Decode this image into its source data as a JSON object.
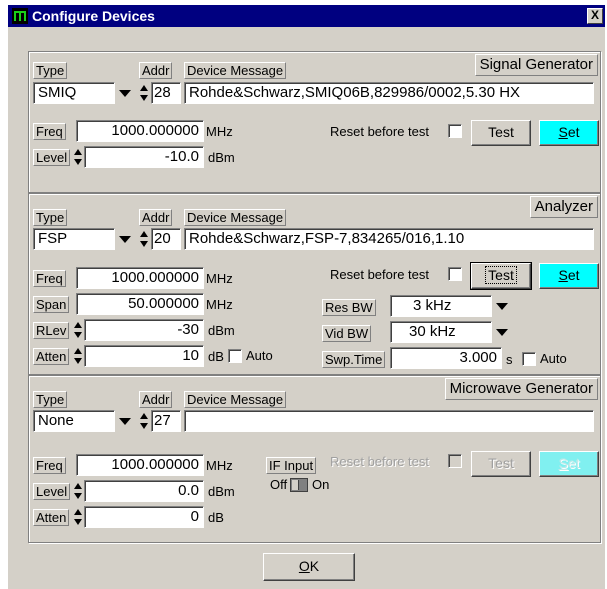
{
  "window": {
    "title": "Configure Devices",
    "close_label": "X"
  },
  "common": {
    "type_label": "Type",
    "addr_label": "Addr",
    "device_message_label": "Device Message",
    "freq_label": "Freq",
    "level_label": "Level",
    "span_label": "Span",
    "rlev_label": "RLev",
    "atten_label": "Atten",
    "mhz": "MHz",
    "dbm": "dBm",
    "db": "dB",
    "s": "s",
    "reset_label": "Reset before test",
    "test_label": "Test",
    "set_label": "Set",
    "auto_label": "Auto"
  },
  "signal_generator": {
    "title": "Signal Generator",
    "type": "SMIQ",
    "addr": "28",
    "device_message": "Rohde&Schwarz,SMIQ06B,829986/0002,5.30 HX",
    "freq": "1000.000000",
    "level": "-10.0",
    "reset_checked": false
  },
  "analyzer": {
    "title": "Analyzer",
    "type": "FSP",
    "addr": "20",
    "device_message": "Rohde&Schwarz,FSP-7,834265/016,1.10",
    "freq": "1000.000000",
    "span": "50.000000",
    "rlev": "-30",
    "atten": "10",
    "atten_auto": false,
    "reset_checked": false,
    "res_bw_label": "Res BW",
    "res_bw": "3 kHz",
    "vid_bw_label": "Vid BW",
    "vid_bw": "30 kHz",
    "swp_time_label": "Swp.Time",
    "swp_time": "3.000",
    "swp_auto": false
  },
  "microwave_generator": {
    "title": "Microwave Generator",
    "type": "None",
    "addr": "27",
    "device_message": "",
    "freq": "1000.000000",
    "level": "0.0",
    "atten": "0",
    "if_input_label": "IF Input",
    "off_label": "Off",
    "on_label": "On",
    "reset_checked": false
  },
  "ok_label": "OK",
  "colors": {
    "title_bar": "#000080",
    "set_button": "#00ffff",
    "dialog_bg": "#d4d0c8"
  }
}
